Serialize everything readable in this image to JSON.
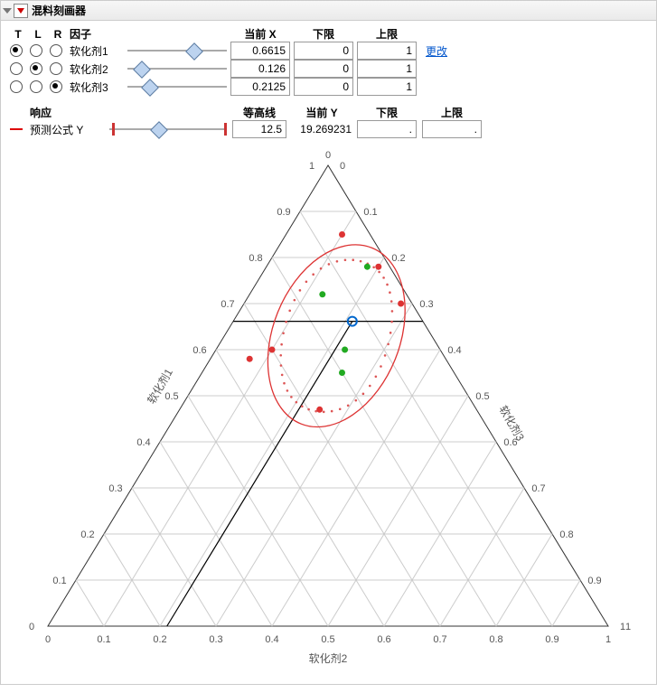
{
  "panel": {
    "title": "混料刻画器"
  },
  "headers": {
    "T": "T",
    "L": "L",
    "R": "R",
    "factor": "因子",
    "curX": "当前 X",
    "lo": "下限",
    "hi": "上限",
    "change": "更改",
    "response": "响应",
    "contour": "等高线",
    "curY": "当前 Y"
  },
  "factors": [
    {
      "name": "软化剂1",
      "T": true,
      "L": false,
      "R": false,
      "slider": 0.66,
      "curX": "0.6615",
      "lo": "0",
      "hi": "1"
    },
    {
      "name": "软化剂2",
      "T": false,
      "L": true,
      "R": false,
      "slider": 0.13,
      "curX": "0.126",
      "lo": "0",
      "hi": "1"
    },
    {
      "name": "软化剂3",
      "T": false,
      "L": false,
      "R": true,
      "slider": 0.21,
      "curX": "0.2125",
      "lo": "0",
      "hi": "1"
    }
  ],
  "response": {
    "name": "预测公式 Y",
    "slider": 0.42,
    "sliderBar": 0.98,
    "contour": "12.5",
    "curY": "19.269231",
    "lo": ".",
    "hi": "."
  },
  "chart_data": {
    "type": "ternary",
    "axes": {
      "top": "软化剂1",
      "left": "软化剂2",
      "right": "软化剂3"
    },
    "ticks": [
      "0",
      "0.1",
      "0.2",
      "0.3",
      "0.4",
      "0.5",
      "0.6",
      "0.7",
      "0.8",
      "0.9",
      "1"
    ],
    "apex_labels": {
      "top": "0",
      "bottom_left": "1",
      "bottom_right": "1",
      "left_top": "1",
      "left_bottom": "0",
      "right_top": "0",
      "right_bottom": "1"
    },
    "current_point": {
      "p1": 0.6615,
      "p2": 0.126,
      "p3": 0.2125
    },
    "contour": {
      "type": "ellipse",
      "level": 12.5,
      "center": [
        0.62,
        0.18,
        0.2
      ]
    },
    "design_points_red": [
      {
        "p1": 0.85,
        "p2": 0.05,
        "p3": 0.1
      },
      {
        "p1": 0.78,
        "p2": 0.02,
        "p3": 0.2
      },
      {
        "p1": 0.7,
        "p2": 0.02,
        "p3": 0.28
      },
      {
        "p1": 0.6,
        "p2": 0.3,
        "p3": 0.1
      },
      {
        "p1": 0.47,
        "p2": 0.28,
        "p3": 0.25
      },
      {
        "p1": 0.58,
        "p2": 0.35,
        "p3": 0.07
      }
    ],
    "design_points_green": [
      {
        "p1": 0.72,
        "p2": 0.15,
        "p3": 0.13
      },
      {
        "p1": 0.78,
        "p2": 0.04,
        "p3": 0.18
      },
      {
        "p1": 0.6,
        "p2": 0.17,
        "p3": 0.23
      },
      {
        "p1": 0.55,
        "p2": 0.2,
        "p3": 0.25
      }
    ],
    "ref_lines": [
      {
        "from": [
          0.6615,
          0.0,
          0.3385
        ],
        "to": [
          0.6615,
          0.3385,
          0.0
        ]
      },
      {
        "from": [
          0.126,
          0.874,
          0.0
        ],
        "to": [
          0.6615,
          0.126,
          0.2125
        ],
        "axis": "L"
      },
      {
        "from": [
          0.0,
          0.7875,
          0.2125
        ],
        "to": [
          0.6615,
          0.126,
          0.2125
        ],
        "axis": "R"
      }
    ]
  }
}
